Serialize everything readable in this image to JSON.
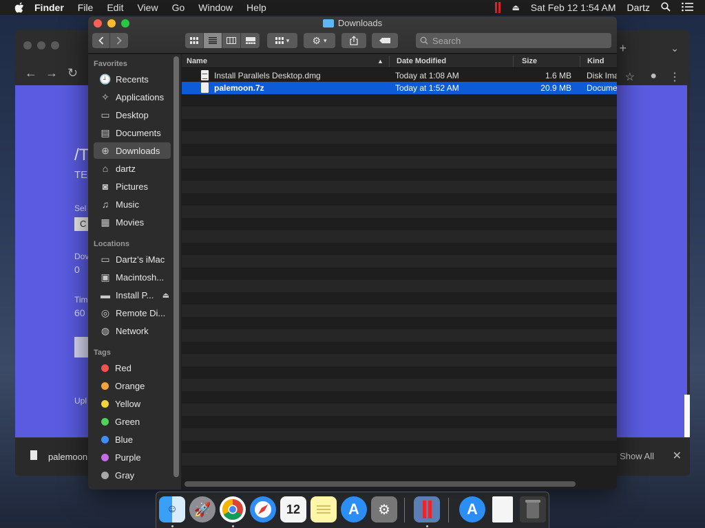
{
  "menubar": {
    "app_name": "Finder",
    "menus": [
      "File",
      "Edit",
      "View",
      "Go",
      "Window",
      "Help"
    ],
    "datetime": "Sat Feb 12  1:54 AM",
    "user": "Dartz"
  },
  "background_window": {
    "download_file": "palemoon",
    "show_all": "Show All",
    "close": "✕",
    "left_text": {
      "title": "/T",
      "sub": "TE",
      "sel": "Sel",
      "sel_box": "C",
      "dov": "Dov",
      "dov_val": "0",
      "tim": "Tim",
      "tim_val": "60",
      "upl": "Upl"
    }
  },
  "finder": {
    "title": "Downloads",
    "search_placeholder": "Search",
    "sidebar": {
      "favorites_heading": "Favorites",
      "favorites": [
        {
          "label": "Recents",
          "icon": "recents-icon"
        },
        {
          "label": "Applications",
          "icon": "applications-icon"
        },
        {
          "label": "Desktop",
          "icon": "desktop-icon"
        },
        {
          "label": "Documents",
          "icon": "documents-icon"
        },
        {
          "label": "Downloads",
          "icon": "downloads-icon"
        },
        {
          "label": "dartz",
          "icon": "home-icon"
        },
        {
          "label": "Pictures",
          "icon": "pictures-icon"
        },
        {
          "label": "Music",
          "icon": "music-icon"
        },
        {
          "label": "Movies",
          "icon": "movies-icon"
        }
      ],
      "locations_heading": "Locations",
      "locations": [
        {
          "label": "Dartz’s iMac",
          "icon": "imac-icon"
        },
        {
          "label": "Macintosh...",
          "icon": "disk-icon"
        },
        {
          "label": "Install P...",
          "icon": "disk-image-icon"
        },
        {
          "label": "Remote Di...",
          "icon": "remote-disc-icon"
        },
        {
          "label": "Network",
          "icon": "network-icon"
        }
      ],
      "tags_heading": "Tags",
      "tags": [
        {
          "label": "Red",
          "color": "#f0544f"
        },
        {
          "label": "Orange",
          "color": "#f7a23b"
        },
        {
          "label": "Yellow",
          "color": "#f5d33a"
        },
        {
          "label": "Green",
          "color": "#4fd15a"
        },
        {
          "label": "Blue",
          "color": "#3b8ff5"
        },
        {
          "label": "Purple",
          "color": "#c46be8"
        },
        {
          "label": "Gray",
          "color": "#a8a8a8"
        }
      ]
    },
    "columns": {
      "name": "Name",
      "date": "Date Modified",
      "size": "Size",
      "kind": "Kind"
    },
    "files": [
      {
        "name": "Install Parallels Desktop.dmg",
        "date": "Today at 1:08 AM",
        "size": "1.6 MB",
        "kind": "Disk Ima"
      },
      {
        "name": "palemoon.7z",
        "date": "Today at 1:52 AM",
        "size": "20.9 MB",
        "kind": "Docume"
      }
    ]
  },
  "colors": {
    "selection": "#0e5bd8",
    "accent_page": "#5a5be0"
  }
}
